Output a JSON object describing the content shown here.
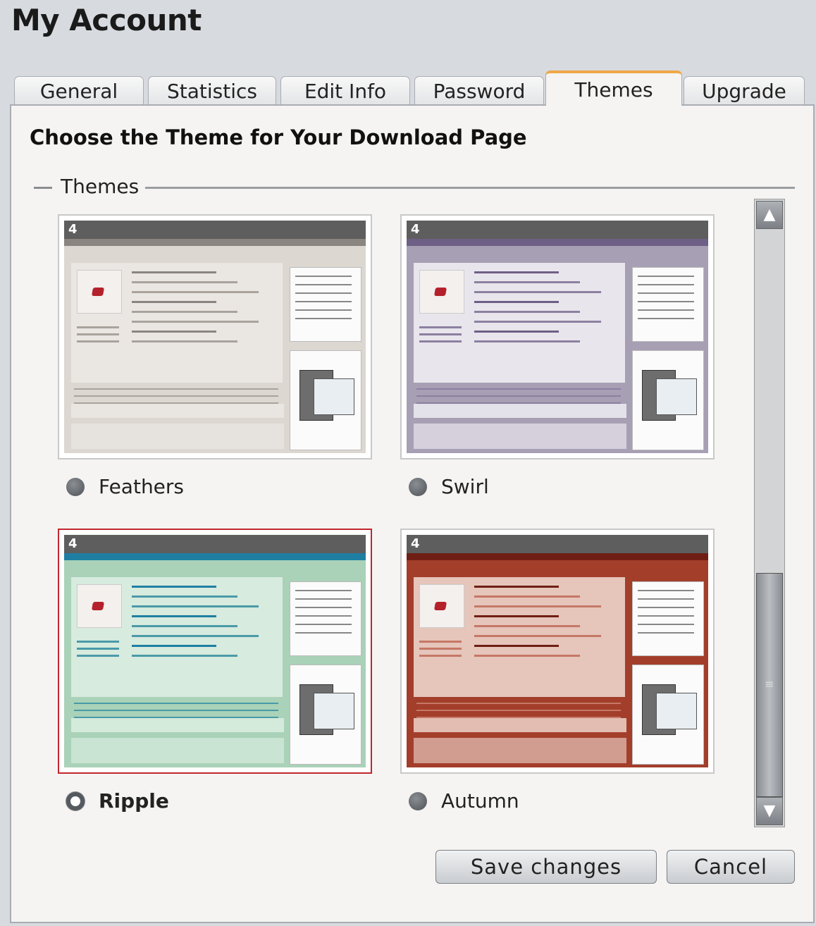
{
  "page": {
    "title": "My Account"
  },
  "tabs": [
    {
      "label": "General",
      "active": false
    },
    {
      "label": "Statistics",
      "active": false
    },
    {
      "label": "Edit Info",
      "active": false
    },
    {
      "label": "Password",
      "active": false
    },
    {
      "label": "Themes",
      "active": true
    },
    {
      "label": "Upgrade",
      "active": false
    }
  ],
  "panel": {
    "heading": "Choose the Theme for Your Download Page",
    "fieldset_legend": "Themes"
  },
  "themes": [
    {
      "name": "Feathers",
      "selected": false,
      "colors": {
        "bg": "#dcd7d1",
        "box": "#ece9e5",
        "accent": "#8a8580",
        "line": "#a9a39c"
      }
    },
    {
      "name": "Swirl",
      "selected": false,
      "colors": {
        "bg": "#a79fb3",
        "box": "#f3f1f6",
        "accent": "#6e5f86",
        "line": "#8c80a0"
      }
    },
    {
      "name": "Ripple",
      "selected": true,
      "colors": {
        "bg": "#a9d2b8",
        "box": "#dff0e4",
        "accent": "#1f7fa2",
        "line": "#4a9aa8"
      }
    },
    {
      "name": "Autumn",
      "selected": false,
      "colors": {
        "bg": "#a33e2b",
        "box": "#f2ddd5",
        "accent": "#6f1e14",
        "line": "#c57866"
      }
    }
  ],
  "thumb_logo": "4",
  "buttons": {
    "save": "Save changes",
    "cancel": "Cancel"
  },
  "scrollbar": {
    "up_icon": "▲",
    "down_icon": "▼",
    "grip_icon": "≡"
  }
}
